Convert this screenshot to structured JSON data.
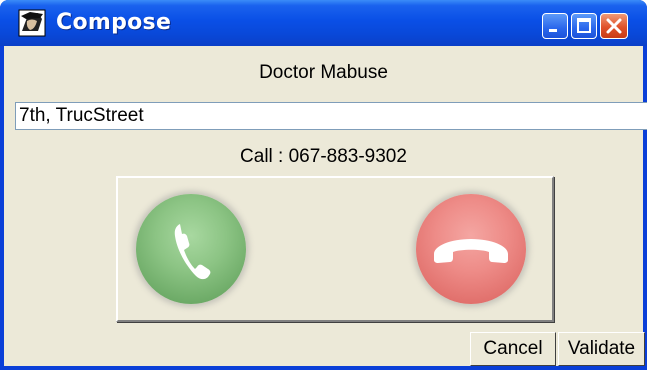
{
  "window": {
    "title": "Compose",
    "app_icon": "user-face-icon",
    "controls": {
      "minimize": "minimize-icon",
      "maximize": "maximize-icon",
      "close": "close-icon"
    }
  },
  "contact": {
    "name": "Doctor Mabuse",
    "address": "7th, TrucStreet",
    "call_text": "Call : 067-883-9302"
  },
  "call_panel": {
    "accept_icon": "phone-accept-icon",
    "hangup_icon": "phone-hangup-icon",
    "accept_color": "#8cc484",
    "hangup_color": "#ee8c88"
  },
  "buttons": {
    "cancel": "Cancel",
    "validate": "Validate"
  }
}
